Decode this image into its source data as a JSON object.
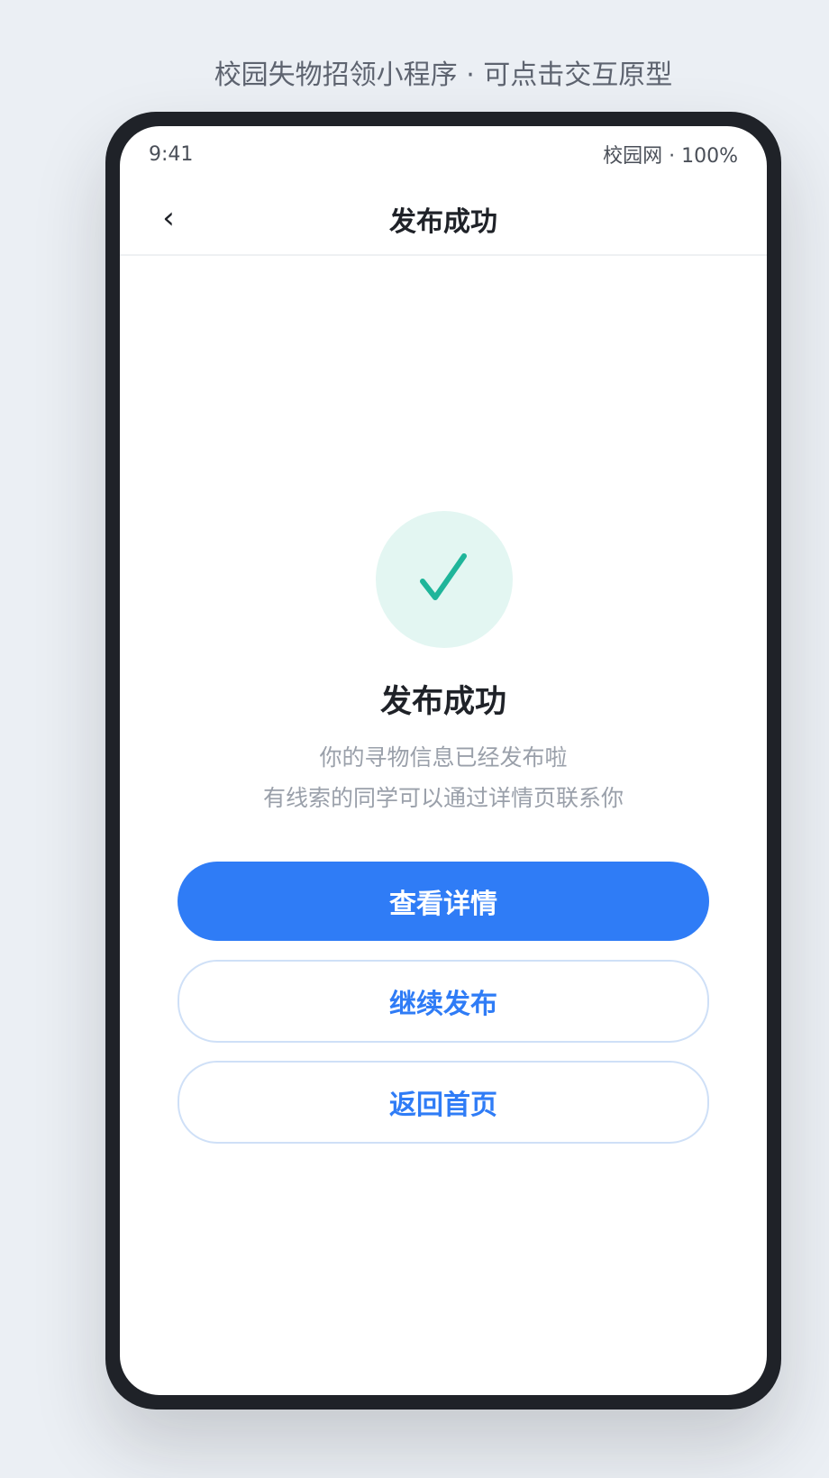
{
  "caption": "校园失物招领小程序 · 可点击交互原型",
  "status_bar": {
    "time": "9:41",
    "right": "校园网 · 100%"
  },
  "nav": {
    "back_icon": "‹",
    "title": "发布成功"
  },
  "result": {
    "icon": "check-icon",
    "title": "发布成功",
    "desc_line1": "你的寻物信息已经发布啦",
    "desc_line2": "有线索的同学可以通过详情页联系你"
  },
  "actions": {
    "view_detail": "查看详情",
    "continue_publish": "继续发布",
    "back_home": "返回首页"
  },
  "colors": {
    "primary": "#2f7cf6",
    "success": "#1fb59a",
    "success_bg": "#e3f6f2",
    "frame": "#1f2228",
    "background": "#ebeff4"
  }
}
